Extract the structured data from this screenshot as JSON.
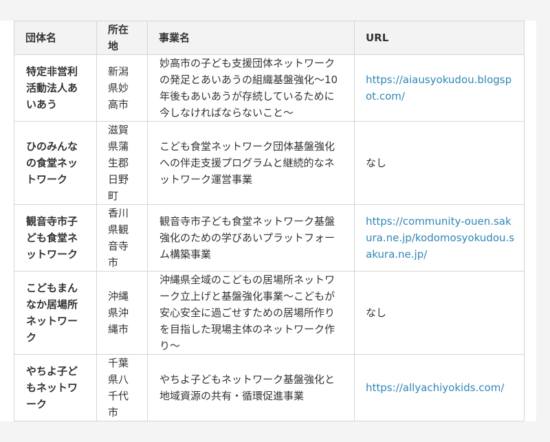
{
  "table": {
    "headers": {
      "name": "団体名",
      "location": "所在地",
      "project": "事業名",
      "url": "URL"
    },
    "rows": [
      {
        "name": "特定非営利活動法人あいあう",
        "location": "新潟県妙高市",
        "project": "妙高市の子ども支援団体ネットワークの発足とあいあうの組織基盤強化〜10年後もあいあうが存続しているために今しなければならないこと〜",
        "url": "https://aiausyokudou.blogspot.com/"
      },
      {
        "name": "ひのみんなの食堂ネットワーク",
        "location": "滋賀県蒲生郡日野町",
        "project": "こども食堂ネットワーク団体基盤強化への伴走支援プログラムと継続的なネットワーク運営事業",
        "url": "なし"
      },
      {
        "name": "観音寺市子ども食堂ネットワーク",
        "location": "香川県観音寺市",
        "project": "観音寺市子ども食堂ネットワーク基盤強化のための学びあいプラットフォーム構築事業",
        "url": "https://community-ouen.sakura.ne.jp/kodomosyokudou.sakura.ne.jp/"
      },
      {
        "name": "こどもまんなか居場所ネットワーク",
        "location": "沖縄県沖縄市",
        "project": "沖縄県全域のこどもの居場所ネットワーク立上げと基盤強化事業〜こどもが安心安全に過ごせすための居場所作りを目指した現場主体のネットワーク作り〜",
        "url": "なし"
      },
      {
        "name": "やちよ子どもネットワーク",
        "location": "千葉県八千代市",
        "project": "やちよ子どもネットワーク基盤強化と地域資源の共有・循環促進事業",
        "url": "https://allyachiyokids.com/"
      }
    ]
  }
}
